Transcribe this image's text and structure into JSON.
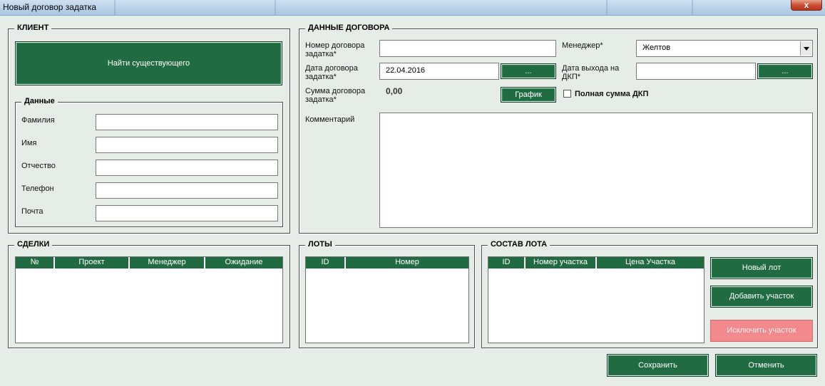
{
  "window": {
    "title": "Новый договор задатка",
    "close_label": "x"
  },
  "client": {
    "legend": "КЛИЕНТ",
    "find_button": "Найти существующего",
    "data_legend": "Данные",
    "fields": [
      {
        "label": "Фамилия",
        "value": ""
      },
      {
        "label": "Имя",
        "value": ""
      },
      {
        "label": "Отчество",
        "value": ""
      },
      {
        "label": "Телефон",
        "value": ""
      },
      {
        "label": "Почта",
        "value": ""
      }
    ]
  },
  "contract": {
    "legend": "ДАННЫЕ ДОГОВОРА",
    "number_label": "Номер договора задатка*",
    "number_value": "",
    "date_label": "Дата договора задатка*",
    "date_value": "22.04.2016",
    "date_button": "...",
    "sum_label": "Сумма договора задатка*",
    "sum_value": "0,00",
    "schedule_button": "График",
    "manager_label": "Менеджер*",
    "manager_value": "Желтов",
    "exit_date_label": "Дата выхода на ДКП*",
    "exit_date_value": "",
    "exit_date_button": "...",
    "full_sum_label": "Полная сумма ДКП",
    "full_sum_checked": false,
    "comment_label": "Комментарий",
    "comment_value": ""
  },
  "deals": {
    "legend": "СДЕЛКИ",
    "columns": [
      "№",
      "Проект",
      "Менеджер",
      "Ожидание"
    ],
    "rows": []
  },
  "lots": {
    "legend": "ЛОТЫ",
    "columns": [
      "ID",
      "Номер"
    ],
    "rows": []
  },
  "lot_composition": {
    "legend": "СОСТАВ ЛОТА",
    "columns": [
      "ID",
      "Номер участка",
      "Цена Участка"
    ],
    "rows": [],
    "new_lot_button": "Новый лот",
    "add_plot_button": "Добавить участок",
    "exclude_plot_button": "Исключить участок"
  },
  "footer": {
    "save_button": "Сохранить",
    "cancel_button": "Отменить"
  },
  "colors": {
    "accent_green": "#216b43",
    "disabled_pink": "#f2898c",
    "background": "#e6ede9"
  }
}
